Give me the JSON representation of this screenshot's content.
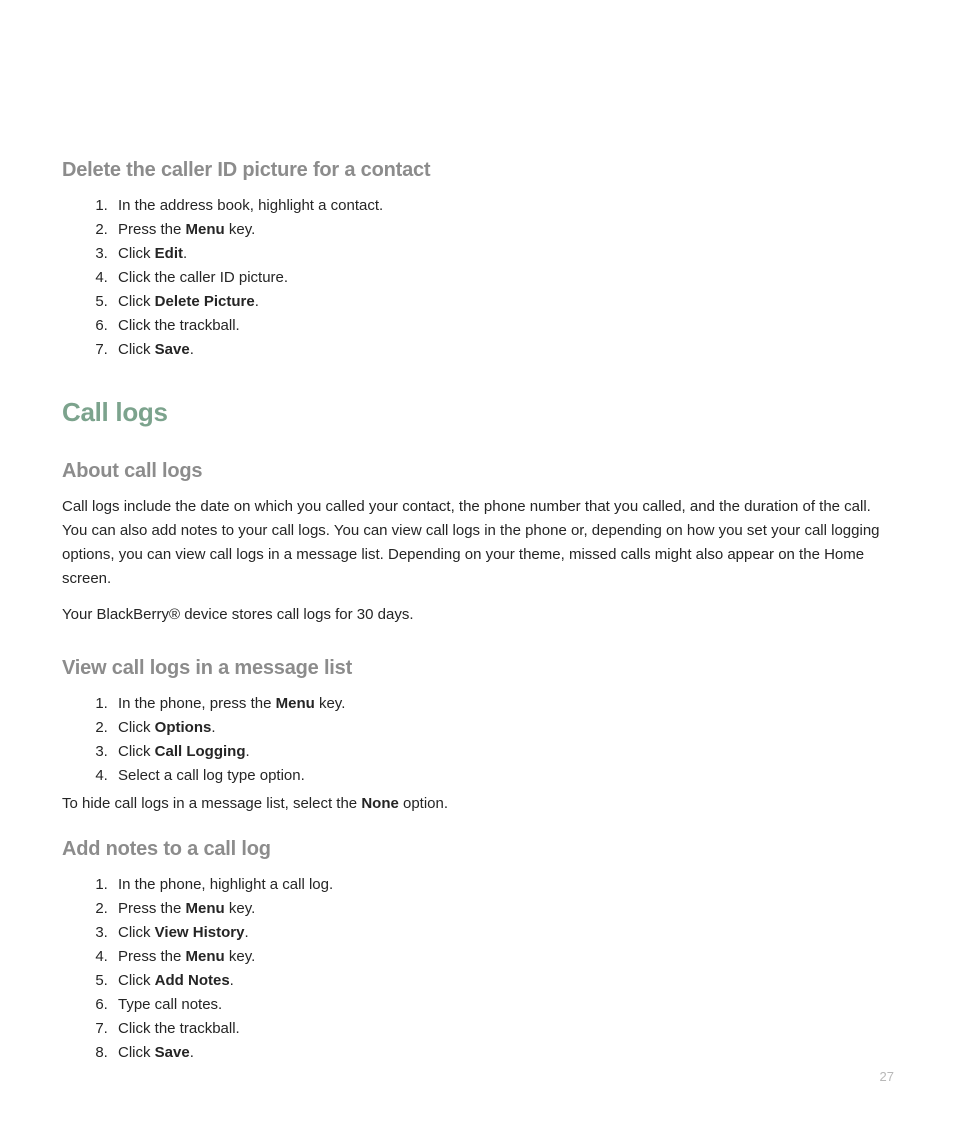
{
  "page_number": "27",
  "sections": {
    "delete_caller_id": {
      "heading": "Delete the caller ID picture for a contact",
      "steps": [
        [
          {
            "t": "In the address book, highlight a contact."
          }
        ],
        [
          {
            "t": "Press the "
          },
          {
            "b": "Menu"
          },
          {
            "t": " key."
          }
        ],
        [
          {
            "t": "Click "
          },
          {
            "b": "Edit"
          },
          {
            "t": "."
          }
        ],
        [
          {
            "t": "Click the caller ID picture."
          }
        ],
        [
          {
            "t": "Click "
          },
          {
            "b": "Delete Picture"
          },
          {
            "t": "."
          }
        ],
        [
          {
            "t": "Click the trackball."
          }
        ],
        [
          {
            "t": "Click "
          },
          {
            "b": "Save"
          },
          {
            "t": "."
          }
        ]
      ]
    },
    "call_logs_heading": "Call logs",
    "about_call_logs": {
      "heading": "About call logs",
      "para1": "Call logs include the date on which you called your contact, the phone number that you called, and the duration of the call. You can also add notes to your call logs. You can view call logs in the phone or, depending on how you set your call logging options, you can view call logs in a message list. Depending on your theme, missed calls might also appear on the Home screen.",
      "para2": "Your BlackBerry® device stores call logs for 30 days."
    },
    "view_call_logs": {
      "heading": "View call logs in a message list",
      "steps": [
        [
          {
            "t": "In the phone, press the "
          },
          {
            "b": "Menu"
          },
          {
            "t": " key."
          }
        ],
        [
          {
            "t": "Click "
          },
          {
            "b": "Options"
          },
          {
            "t": "."
          }
        ],
        [
          {
            "t": "Click "
          },
          {
            "b": "Call Logging"
          },
          {
            "t": "."
          }
        ],
        [
          {
            "t": "Select a call log type option."
          }
        ]
      ],
      "trailing": [
        {
          "t": "To hide call logs in a message list, select the "
        },
        {
          "b": "None"
        },
        {
          "t": " option."
        }
      ]
    },
    "add_notes": {
      "heading": "Add notes to a call log",
      "steps": [
        [
          {
            "t": "In the phone, highlight a call log."
          }
        ],
        [
          {
            "t": "Press the "
          },
          {
            "b": "Menu"
          },
          {
            "t": " key."
          }
        ],
        [
          {
            "t": "Click "
          },
          {
            "b": "View History"
          },
          {
            "t": "."
          }
        ],
        [
          {
            "t": "Press the "
          },
          {
            "b": "Menu"
          },
          {
            "t": " key."
          }
        ],
        [
          {
            "t": "Click "
          },
          {
            "b": "Add Notes"
          },
          {
            "t": "."
          }
        ],
        [
          {
            "t": "Type call notes."
          }
        ],
        [
          {
            "t": "Click the trackball."
          }
        ],
        [
          {
            "t": "Click "
          },
          {
            "b": "Save"
          },
          {
            "t": "."
          }
        ]
      ]
    }
  }
}
